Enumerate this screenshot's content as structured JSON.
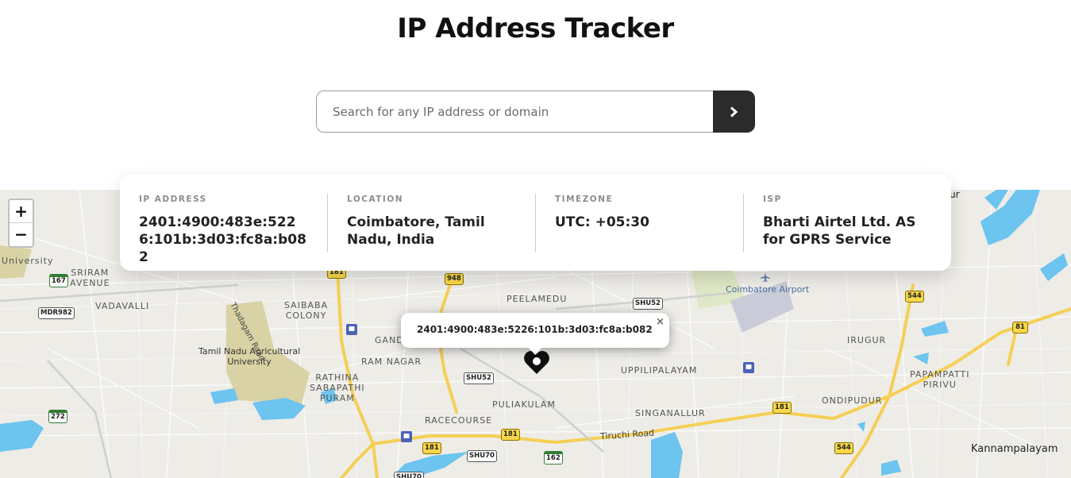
{
  "header": {
    "title": "IP Address Tracker"
  },
  "search": {
    "placeholder": "Search for any IP address or domain",
    "value": ""
  },
  "info": {
    "ip": {
      "label": "IP ADDRESS",
      "value": "2401:4900:483e:5226:101b:3d03:fc8a:b082"
    },
    "location": {
      "label": "LOCATION",
      "value": "Coimbatore, Tamil Nadu, India"
    },
    "timezone": {
      "label": "TIMEZONE",
      "value": "UTC: +05:30"
    },
    "isp": {
      "label": "ISP",
      "value": "Bharti Airtel Ltd. AS for GPRS Service"
    }
  },
  "map": {
    "zoom_in": "+",
    "zoom_out": "−",
    "popup_text": "2401:4900:483e:5226:101b:3d03:fc8a:b082",
    "popup_close": "×",
    "labels": {
      "university": "University",
      "sriram": "SRIRAM\nAVENUE",
      "vadavalli": "VADAVALLI",
      "saibaba": "SAIBABA\nCOLONY",
      "tnau": "Tamil Nadu Agricultural\nUniversity",
      "thadagam": "Thadagam Road",
      "gandhi": "GAND",
      "ramnagar": "RAM NAGAR",
      "rathina": "RATHINA\nSABAPATHI\nPURAM",
      "racecourse": "RACECOURSE",
      "puliakulam": "PULIAKULAM",
      "peelamedu": "PEELAMEDU",
      "uppilipalayam": "UPPILIPALAYAM",
      "singanallur": "SINGANALLUR",
      "airport": "Coimbatore Airport",
      "irugur": "IRUGUR",
      "papampatti": "PAPAMPATTI\nPIRIVU",
      "ondipudur": "ONDIPUDUR",
      "kannampalayam": "Kannampalayam",
      "tiruchi": "Tiruchi Road",
      "ur": "ur"
    },
    "shields": {
      "s167": "167",
      "mdr982": "MDR982",
      "s272": "272",
      "s181a": "181",
      "s948": "948",
      "shu52a": "SHU52",
      "shu52b": "SHU52",
      "s181b": "181",
      "s181c": "181",
      "shu70a": "SHU70",
      "shu70b": "SHU70",
      "s162": "162",
      "s181d": "181",
      "s544a": "544",
      "s81": "81",
      "s544b": "544"
    },
    "colors": {
      "land": "#eeece7",
      "water": "#6cc4ef",
      "road_major": "#f5cf55",
      "park": "#d9d2a4"
    }
  }
}
